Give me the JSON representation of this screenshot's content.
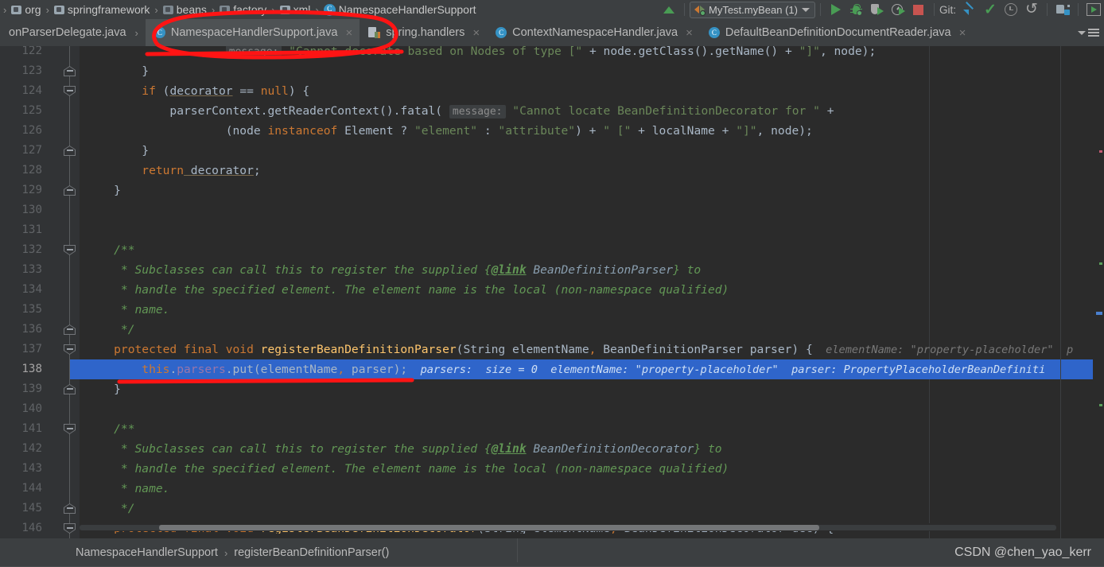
{
  "navbar": {
    "breadcrumbs": [
      {
        "label": "org",
        "icon": "package-icon"
      },
      {
        "label": "springframework",
        "icon": "package-icon"
      },
      {
        "label": "beans",
        "icon": "package-icon"
      },
      {
        "label": "factory",
        "icon": "package-icon"
      },
      {
        "label": "xml",
        "icon": "package-icon"
      },
      {
        "label": "NamespaceHandlerSupport",
        "icon": "class-icon"
      }
    ],
    "separator": "›"
  },
  "toolbar": {
    "run_configuration": "MyTest.myBean (1)",
    "git_label": "Git:",
    "buttons": [
      {
        "name": "build-button",
        "icon": "hammer-icon"
      },
      {
        "name": "run-button",
        "icon": "run-icon"
      },
      {
        "name": "debug-button",
        "icon": "debug-bug-icon"
      },
      {
        "name": "run-with-coverage-button",
        "icon": "coverage-shield-icon"
      },
      {
        "name": "profile-button",
        "icon": "profiler-clock-icon"
      },
      {
        "name": "stop-button",
        "icon": "stop-square-icon"
      },
      {
        "name": "git-update-button",
        "icon": "update-project-icon"
      },
      {
        "name": "git-commit-button",
        "icon": "commit-check-icon"
      },
      {
        "name": "git-history-button",
        "icon": "history-clock-icon"
      },
      {
        "name": "git-rollback-button",
        "icon": "rollback-undo-icon"
      },
      {
        "name": "project-structure-button",
        "icon": "project-structure-icon"
      },
      {
        "name": "select-run-config-button",
        "icon": "run-box-icon"
      }
    ]
  },
  "tabs": [
    {
      "label": "onParserDelegate.java",
      "icon": "java-class-icon",
      "active": false,
      "truncated": true,
      "closable": false
    },
    {
      "label": "NamespaceHandlerSupport.java",
      "icon": "java-class-icon",
      "active": true,
      "closable": true
    },
    {
      "label": "spring.handlers",
      "icon": "properties-file-icon",
      "active": false,
      "closable": true
    },
    {
      "label": "ContextNamespaceHandler.java",
      "icon": "java-class-icon",
      "active": false,
      "closable": true
    },
    {
      "label": "DefaultBeanDefinitionDocumentReader.java",
      "icon": "java-class-icon",
      "active": false,
      "closable": true
    }
  ],
  "editor": {
    "first_line": 122,
    "selected_line": 138,
    "lines": [
      {
        "n": 122,
        "html": "<span class=\"str\">                    </span><span class=\"hintchip\">message:</span><span class=\"str\"> \"Cannot decorate based on Nodes of type [\"</span><span class=\"id\"> + node.</span><span class=\"id\">getClass</span><span class=\"id\">().</span><span class=\"id\">getName</span><span class=\"id\">() + </span><span class=\"str\">\"]\"</span><span class=\"id\">, node);</span>"
      },
      {
        "n": 123,
        "html": "<span class=\"id\">        }</span>"
      },
      {
        "n": 124,
        "html": "<span class=\"kw\">        if</span><span class=\"id\"> (</span><span class=\"id udl\">decorator</span><span class=\"id\"> == </span><span class=\"kw\">null</span><span class=\"id\">) {</span>"
      },
      {
        "n": 125,
        "html": "<span class=\"id\">            parserContext.getReaderContext().fatal( </span><span class=\"hintchip\">message:</span><span class=\"str\"> \"Cannot locate BeanDefinitionDecorator for \"</span><span class=\"id\"> +</span>"
      },
      {
        "n": 126,
        "html": "<span class=\"id\">                    (node </span><span class=\"kw\">instanceof</span><span class=\"id\"> Element ? </span><span class=\"str\">\"element\"</span><span class=\"id\"> : </span><span class=\"str\">\"attribute\"</span><span class=\"id\">) + </span><span class=\"str\">\" [\"</span><span class=\"id\"> + localName + </span><span class=\"str\">\"]\"</span><span class=\"id\">, node);</span>"
      },
      {
        "n": 127,
        "html": "<span class=\"id\">        }</span>"
      },
      {
        "n": 128,
        "html": "<span class=\"kw\">        return</span><span class=\"id udl\"> decorator</span><span class=\"id\">;</span>"
      },
      {
        "n": 129,
        "html": "<span class=\"id\">    }</span>"
      },
      {
        "n": 130,
        "html": ""
      },
      {
        "n": 131,
        "html": ""
      },
      {
        "n": 132,
        "html": "<span class=\"cm\">    /**</span>"
      },
      {
        "n": 133,
        "html": "<span class=\"cm\">     * Subclasses can call this to register the supplied {</span><span class=\"cmlink\">@link</span><span class=\"cmtype\"> BeanDefinitionParser</span><span class=\"cm\">} to</span>"
      },
      {
        "n": 134,
        "html": "<span class=\"cm\">     * handle the specified element. The element name is the local (non-namespace qualified)</span>"
      },
      {
        "n": 135,
        "html": "<span class=\"cm\">     * name.</span>"
      },
      {
        "n": 136,
        "html": "<span class=\"cm\">     */</span>"
      },
      {
        "n": 137,
        "html": "<span class=\"kw\">    protected final void </span><span class=\"fn\">registerBeanDefinitionParser</span><span class=\"id\">(String elementName</span><span class=\"kw\">,</span><span class=\"id\"> BeanDefinitionParser parser) {</span><span class=\"hint\">  elementName: </span><span class=\"hint hv\">\"property-placeholder\"</span><span class=\"hint\">  p</span>"
      },
      {
        "n": 138,
        "html": "<span class=\"kw\">        this</span><span class=\"id\">.</span><span class=\"fld\">parsers</span><span class=\"id\">.put(elementName</span><span class=\"kw\">,</span><span class=\"id\"> parser);</span><span class=\"hint\">  parsers:  size = 0  elementName: </span><span class=\"hint hv\">\"property-placeholder\"</span><span class=\"hint\">  parser: </span><span class=\"hint hv\">PropertyPlaceholderBeanDefiniti</span>"
      },
      {
        "n": 139,
        "html": "<span class=\"id\">    }</span>"
      },
      {
        "n": 140,
        "html": ""
      },
      {
        "n": 141,
        "html": "<span class=\"cm\">    /**</span>"
      },
      {
        "n": 142,
        "html": "<span class=\"cm\">     * Subclasses can call this to register the supplied {</span><span class=\"cmlink\">@link</span><span class=\"cmtype\"> BeanDefinitionDecorator</span><span class=\"cm\">} to</span>"
      },
      {
        "n": 143,
        "html": "<span class=\"cm\">     * handle the specified element. The element name is the local (non-namespace qualified)</span>"
      },
      {
        "n": 144,
        "html": "<span class=\"cm\">     * name.</span>"
      },
      {
        "n": 145,
        "html": "<span class=\"cm\">     */</span>"
      },
      {
        "n": 146,
        "html": "<span class=\"kw\">    protected final void </span><span class=\"fn\">registerBeanDefinitionDecorator</span><span class=\"id\">(String elementName</span><span class=\"kw\">,</span><span class=\"id\"> BeanDefinitionDecorator dec) {</span>"
      }
    ],
    "inline_hints": {
      "line137": {
        "elementName": "\"property-placeholder\""
      },
      "line138": {
        "parsers_size": "size = 0",
        "elementName": "\"property-placeholder\"",
        "parser": "PropertyPlaceholderBeanDefiniti"
      }
    }
  },
  "status": {
    "breadcrumb": [
      "NamespaceHandlerSupport",
      "registerBeanDefinitionParser()"
    ],
    "breadcrumb_separator": "›",
    "watermark": "CSDN @chen_yao_kerr"
  },
  "colors": {
    "editor_bg": "#2b2b2b",
    "gutter_bg": "#313335",
    "chrome_bg": "#3c3f41",
    "selection": "#2f65ca",
    "keyword": "#cc7832",
    "string": "#6a8759",
    "comment": "#629755",
    "method": "#ffc66d",
    "field": "#9876aa",
    "annotation_red": "#ff1111"
  }
}
